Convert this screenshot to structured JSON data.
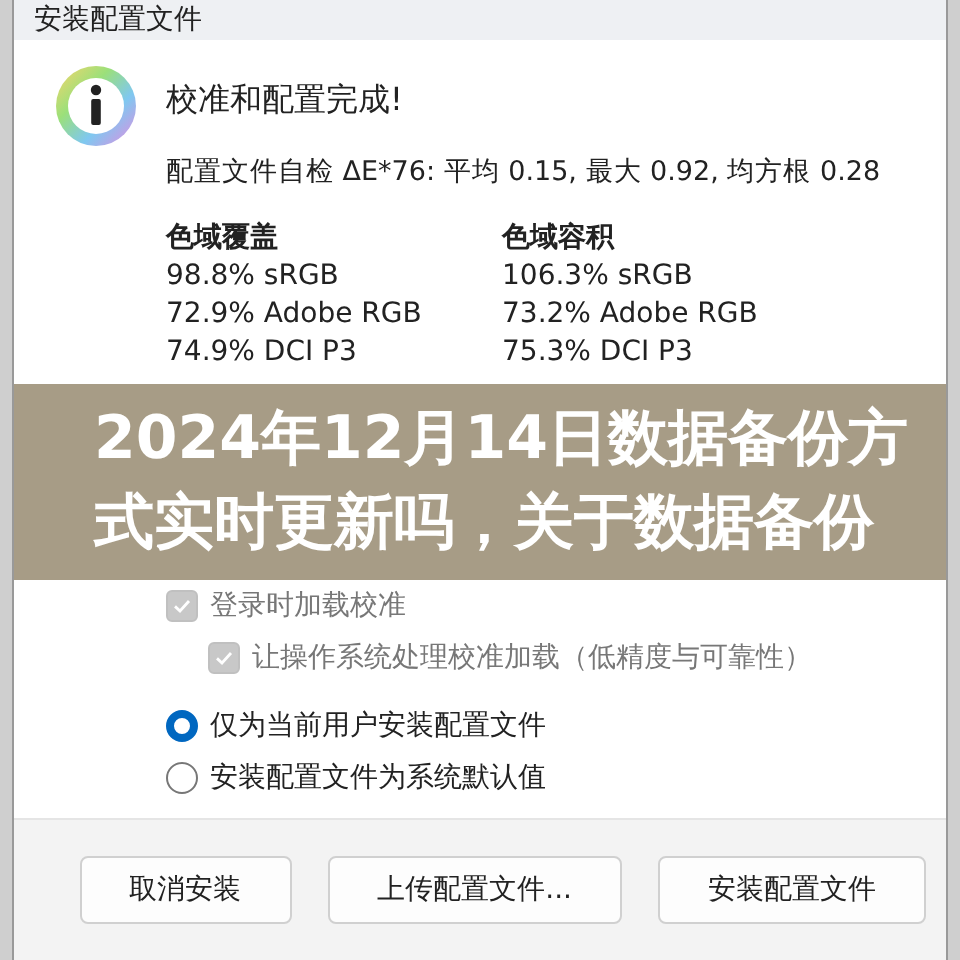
{
  "window": {
    "title": "安装配置文件"
  },
  "message": {
    "heading": "校准和配置完成!",
    "detail": "配置文件自检 ΔE*76: 平均 0.15, 最大 0.92, 均方根 0.28"
  },
  "gamut": [
    {
      "heading": "色域覆盖",
      "rows": [
        "98.8% sRGB",
        "72.9% Adobe RGB",
        "74.9% DCI P3"
      ]
    },
    {
      "heading": "色域容积",
      "rows": [
        "106.3% sRGB",
        "73.2% Adobe RGB",
        "75.3% DCI P3"
      ]
    }
  ],
  "options": [
    {
      "label": "登录时加载校准",
      "checked": true,
      "disabled": true,
      "indented": false
    },
    {
      "label": "让操作系统处理校准加载（低精度与可靠性）",
      "checked": true,
      "disabled": true,
      "indented": true
    }
  ],
  "install_scope": [
    {
      "label": "仅为当前用户安装配置文件",
      "selected": true
    },
    {
      "label": "安装配置文件为系统默认值",
      "selected": false
    }
  ],
  "buttons": [
    "取消安装",
    "上传配置文件...",
    "安装配置文件"
  ],
  "banner": {
    "lines": [
      "2024年12月14日数据备份方",
      "式实时更新吗，关于数据备份"
    ]
  }
}
